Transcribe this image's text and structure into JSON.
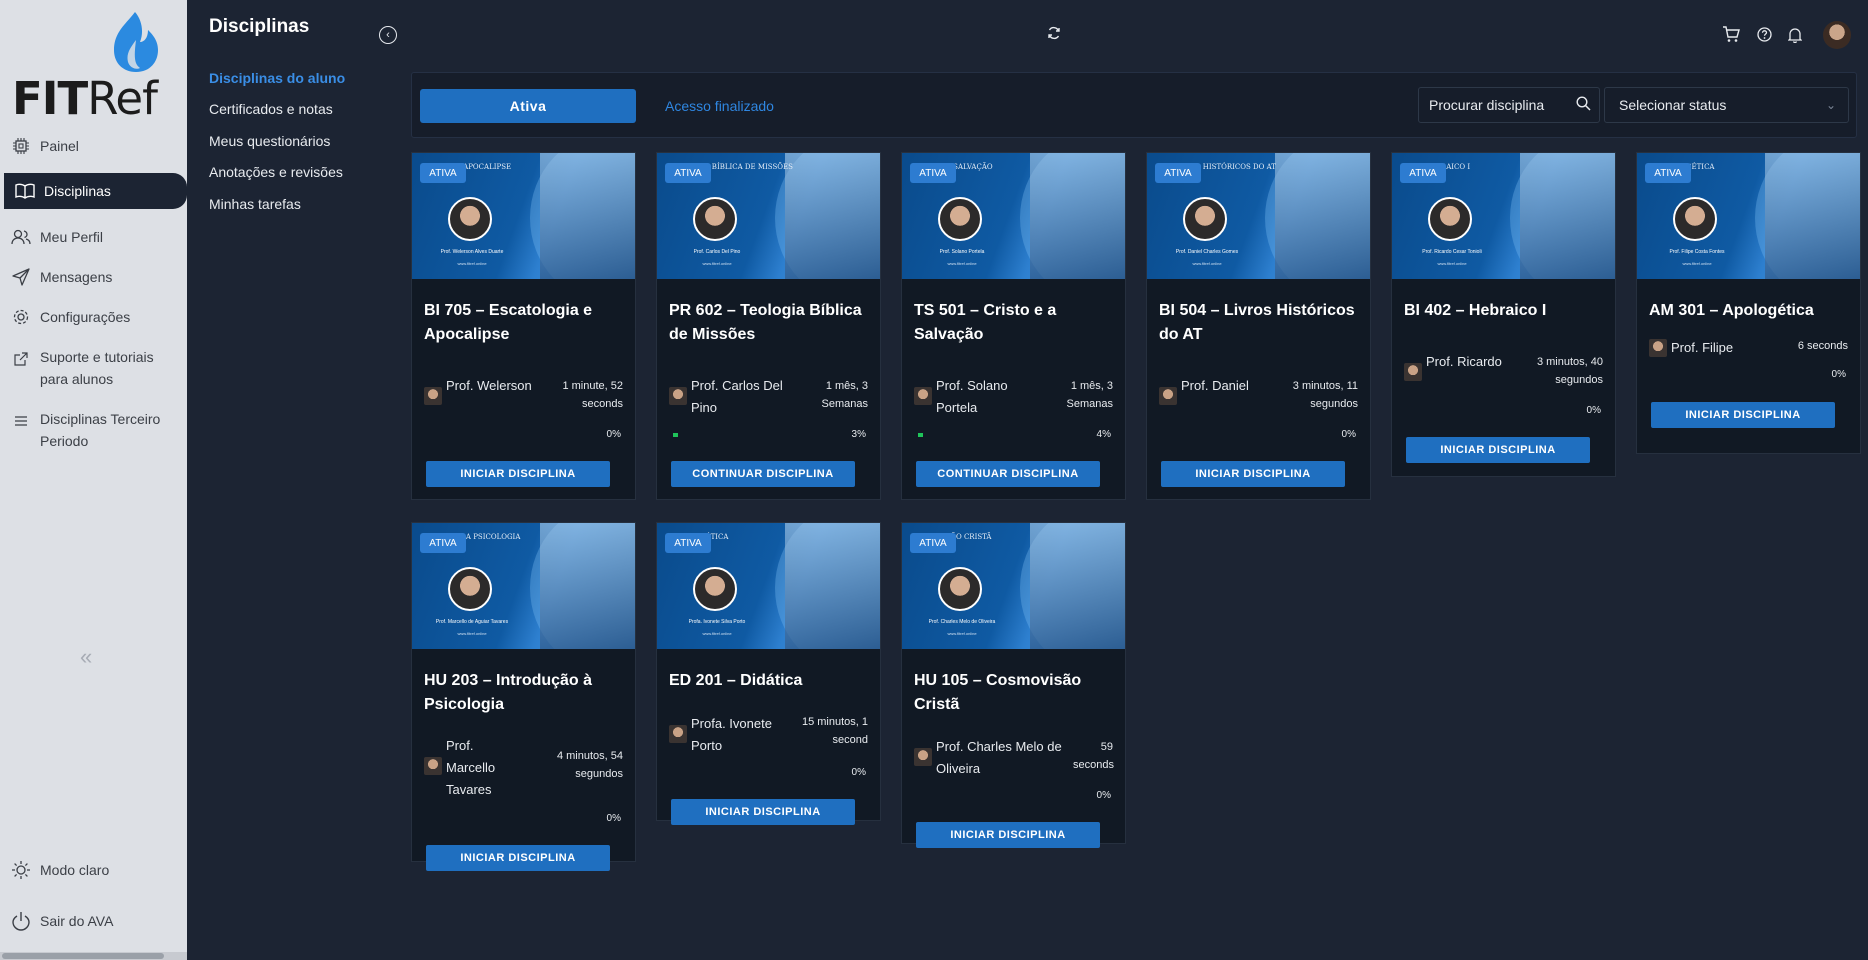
{
  "app": {
    "logo_text": "FITRef"
  },
  "nav": {
    "items": [
      {
        "label": "Painel",
        "icon": "cpu-icon"
      },
      {
        "label": "Disciplinas",
        "icon": "book-icon"
      },
      {
        "label": "Meu Perfil",
        "icon": "users-icon"
      },
      {
        "label": "Mensagens",
        "icon": "send-icon"
      },
      {
        "label": "Configurações",
        "icon": "gear-icon"
      },
      {
        "label": "Suporte e tutoriais para alunos",
        "icon": "external-link-icon"
      },
      {
        "label": "Disciplinas Terceiro Periodo",
        "icon": "menu-icon"
      }
    ],
    "mode_label": "Modo claro",
    "logout_label": "Sair do AVA"
  },
  "submenu": {
    "title": "Disciplinas",
    "items": [
      {
        "label": "Disciplinas do aluno"
      },
      {
        "label": "Certificados e notas"
      },
      {
        "label": "Meus questionários"
      },
      {
        "label": "Anotações e revisões"
      },
      {
        "label": "Minhas tarefas"
      }
    ]
  },
  "filters": {
    "tab_active": "Ativa",
    "tab_inactive": "Acesso finalizado",
    "search_placeholder": "Procurar disciplina",
    "status_label": "Selecionar status"
  },
  "colors": {
    "accent": "#1f6fc0",
    "background": "#1c2433",
    "sidebar": "#dde0e5",
    "progress": "#1fc45a"
  },
  "courses": [
    {
      "badge": "ATIVA",
      "banner_course": "...705 ... APOCALIPSE",
      "banner_prof": "Prof. Welerson Alves Duarte",
      "banner_site": "www.fitref.online",
      "title": "BI 705 – Escatologia e Apocalipse",
      "prof": "Prof. Welerson",
      "time": "1 minute, 52 seconds",
      "progress": "0%",
      "progress_value": 0,
      "button": "INICIAR DISCIPLINA"
    },
    {
      "badge": "ATIVA",
      "banner_course": "...602 T... BÍBLICA DE MISSÕES",
      "banner_prof": "Prof. Carlos Del Pino",
      "banner_site": "www.fitref.online",
      "title": "PR 602 – Teologia Bíblica de Missões",
      "prof": "Prof. Carlos Del Pino",
      "time": "1 mês, 3 Semanas",
      "progress": "3%",
      "progress_value": 3,
      "button": "CONTINUAR DISCIPLINA"
    },
    {
      "badge": "ATIVA",
      "banner_course": "...501 ... SALVAÇÃO",
      "banner_prof": "Prof. Solano Portela",
      "banner_site": "www.fitref.online",
      "title": "TS 501 – Cristo e a Salvação",
      "prof": "Prof. Solano Portela",
      "time": "1 mês, 3 Semanas",
      "progress": "4%",
      "progress_value": 4,
      "button": "CONTINUAR DISCIPLINA"
    },
    {
      "badge": "ATIVA",
      "banner_course": "...504 L... HISTÓRICOS DO AT",
      "banner_prof": "Prof. Daniel Charles Gomes",
      "banner_site": "www.fitref.online",
      "title": "BI 504 – Livros Históricos do AT",
      "prof": "Prof. Daniel",
      "time": "3 minutos, 11 segundos",
      "progress": "0%",
      "progress_value": 0,
      "button": "INICIAR DISCIPLINA"
    },
    {
      "badge": "ATIVA",
      "banner_course": "...402 ...RAICO I",
      "banner_prof": "Prof. Ricardo Cesar Tonioli",
      "banner_site": "www.fitref.online",
      "title": "BI 402 – Hebraico I",
      "prof": "Prof. Ricardo",
      "time": "3 minutos, 40 segundos",
      "progress": "0%",
      "progress_value": 0,
      "button": "INICIAR DISCIPLINA"
    },
    {
      "badge": "ATIVA",
      "banner_course": "...301 ...GÉTICA",
      "banner_prof": "Prof. Filipe Costa Fontes",
      "banner_site": "www.fitref.online",
      "title": "AM 301 – Apologética",
      "prof": "Prof. Filipe",
      "time": "6 seconds",
      "progress": "0%",
      "progress_value": 0,
      "button": "INICIAR DISCIPLINA"
    },
    {
      "badge": "ATIVA",
      "banner_course": "...203 I... A PSICOLOGIA",
      "banner_prof": "Prof. Marcello de Aguiar Tavares",
      "banner_site": "www.fitref.online",
      "title": "HU 203 – Introdução à Psicologia",
      "prof": "Prof. Marcello Tavares",
      "time": "4 minutos, 54 segundos",
      "progress": "0%",
      "progress_value": 0,
      "button": "INICIAR DISCIPLINA"
    },
    {
      "badge": "ATIVA",
      "banner_course": "...201 ...ÁTICA",
      "banner_prof": "Profa. Ivonete Silva Porto",
      "banner_site": "www.fitref.online",
      "title": "ED 201 – Didática",
      "prof": "Profa. Ivonete Porto",
      "time": "15 minutos, 1 second",
      "progress": "0%",
      "progress_value": 0,
      "button": "INICIAR DISCIPLINA"
    },
    {
      "badge": "ATIVA",
      "banner_course": "...105 ...ÃO CRISTÃ",
      "banner_prof": "Prof. Charles Melo de Oliveira",
      "banner_site": "www.fitref.online",
      "title": "HU 105 – Cosmovisão Cristã",
      "prof": "Prof. Charles Melo de Oliveira",
      "time": "59 seconds",
      "progress": "0%",
      "progress_value": 0,
      "button": "INICIAR DISCIPLINA"
    }
  ]
}
